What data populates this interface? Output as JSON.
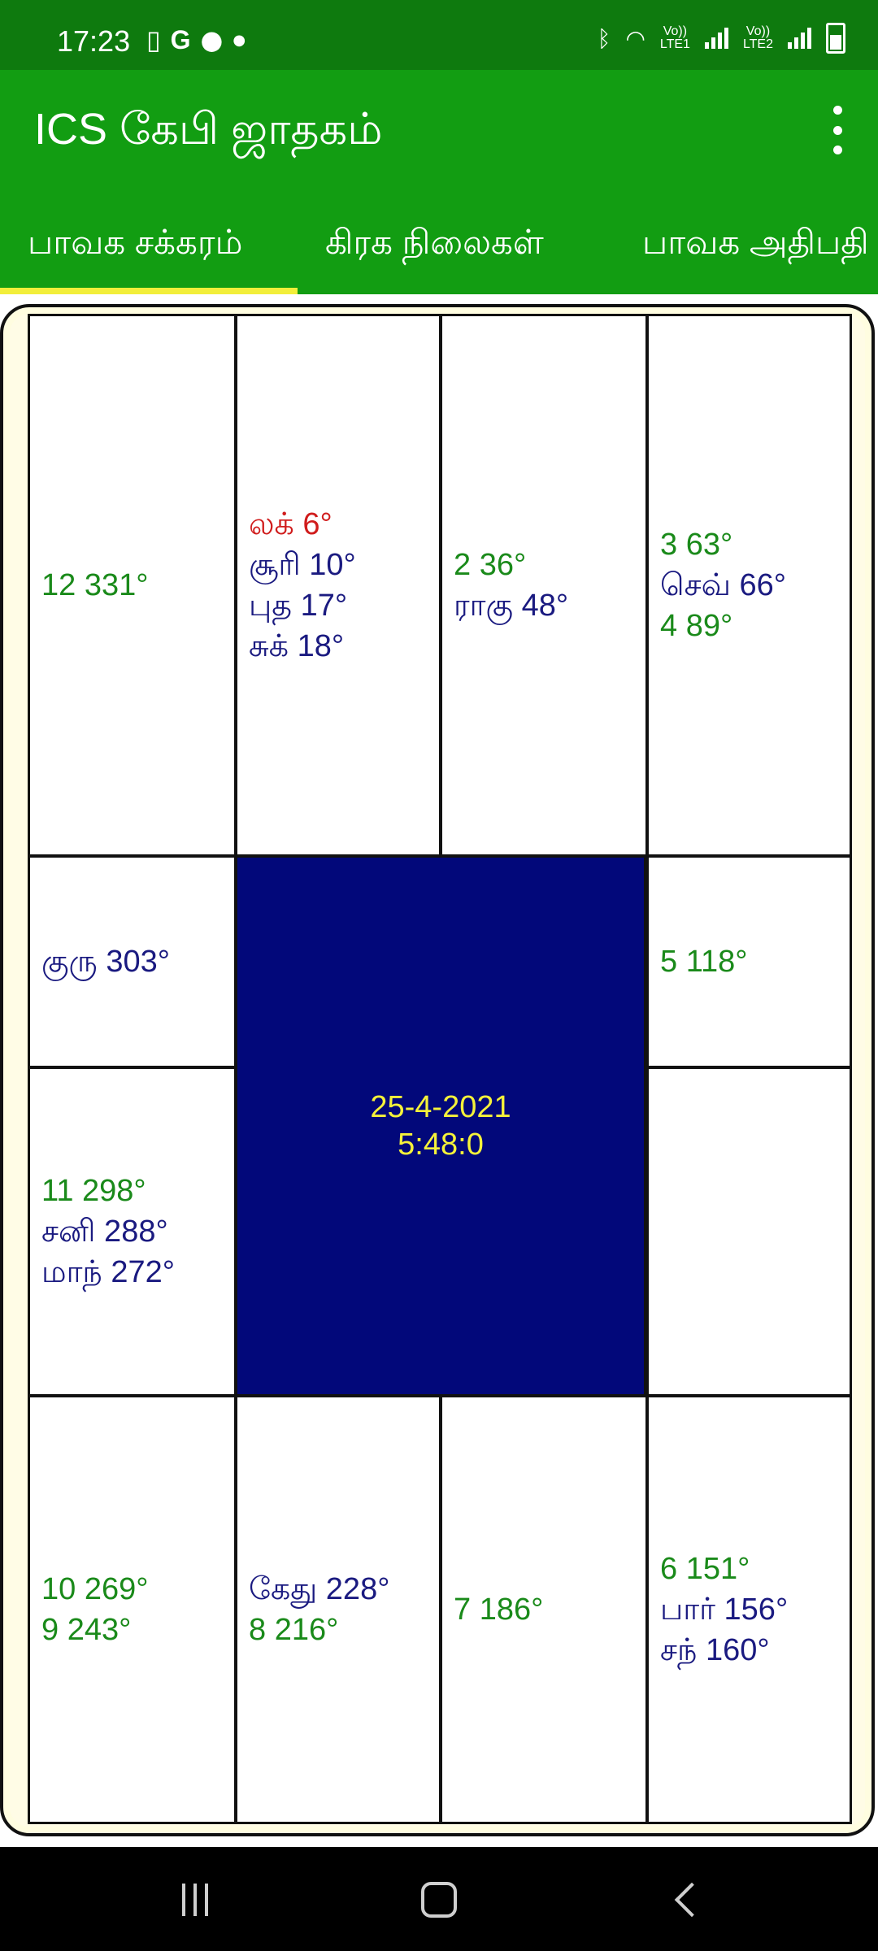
{
  "status_bar": {
    "time": "17:23",
    "left_icons": [
      "phone-icon",
      "google-icon",
      "chat-icon",
      "dot-icon"
    ],
    "right_icons": [
      "bluetooth-icon",
      "wifi-icon",
      "signal-sim1-icon",
      "signal-sim2-icon",
      "battery-icon"
    ],
    "sim1_label_top": "Vo))",
    "sim1_label_bottom": "LTE1",
    "sim2_label_top": "Vo))",
    "sim2_label_bottom": "LTE2"
  },
  "app_bar": {
    "title": "ICS கேபி ஜாதகம்",
    "menu_icon": "more-vert-icon"
  },
  "tabs": [
    {
      "label": "பாவக சக்கரம்",
      "selected": true
    },
    {
      "label": "கிரக நிலைகள்",
      "selected": false
    },
    {
      "label": "பாவக அதிபதி",
      "selected": false
    }
  ],
  "chart": {
    "center_date": "25-4-2021",
    "center_time": "5:48:0",
    "colors": {
      "cusp": "#1a8a1a",
      "planet": "#1a1a80",
      "lagna": "#d01c1c",
      "center_bg": "#02087a",
      "center_text": "#f5f23a"
    },
    "cells": {
      "r1c1": [
        {
          "text": "12 331°",
          "kind": "cusp"
        }
      ],
      "r1c2": [
        {
          "text": "லக் 6°",
          "kind": "lagna"
        },
        {
          "text": "சூரி 10°",
          "kind": "planet"
        },
        {
          "text": "புத 17°",
          "kind": "planet"
        },
        {
          "text": "சுக் 18°",
          "kind": "planet"
        }
      ],
      "r1c3": [
        {
          "text": "2 36°",
          "kind": "cusp"
        },
        {
          "text": "ராகு 48°",
          "kind": "planet"
        }
      ],
      "r1c4": [
        {
          "text": "3 63°",
          "kind": "cusp"
        },
        {
          "text": "செவ் 66°",
          "kind": "planet"
        },
        {
          "text": "4 89°",
          "kind": "cusp"
        }
      ],
      "r2c1": [
        {
          "text": "குரு 303°",
          "kind": "planet"
        }
      ],
      "r2c4": [
        {
          "text": "5 118°",
          "kind": "cusp"
        }
      ],
      "r3c1": [
        {
          "text": "11 298°",
          "kind": "cusp"
        },
        {
          "text": "சனி 288°",
          "kind": "planet"
        },
        {
          "text": "மாந் 272°",
          "kind": "planet"
        }
      ],
      "r3c4": [],
      "r4c1": [
        {
          "text": "10 269°",
          "kind": "cusp"
        },
        {
          "text": "9 243°",
          "kind": "cusp"
        }
      ],
      "r4c2": [
        {
          "text": "கேது 228°",
          "kind": "planet"
        },
        {
          "text": "8 216°",
          "kind": "cusp"
        }
      ],
      "r4c3": [
        {
          "text": "7 186°",
          "kind": "cusp"
        }
      ],
      "r4c4": [
        {
          "text": "6 151°",
          "kind": "cusp"
        },
        {
          "text": "பார் 156°",
          "kind": "planet"
        },
        {
          "text": "சந் 160°",
          "kind": "planet"
        }
      ]
    }
  },
  "nav_bar": {
    "buttons": [
      "recent-apps-icon",
      "home-icon",
      "back-icon"
    ]
  }
}
